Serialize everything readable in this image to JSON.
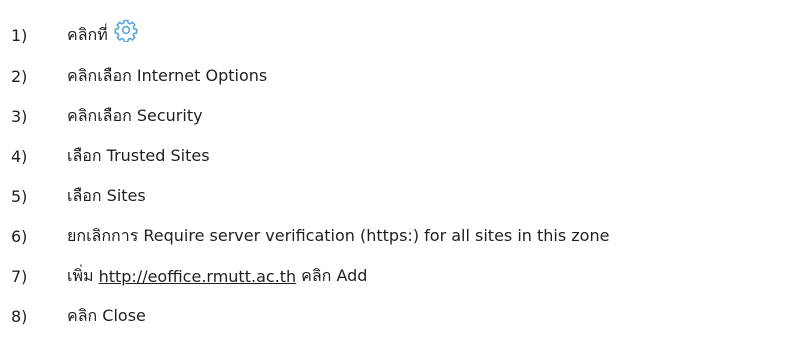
{
  "steps": [
    {
      "num": "1)",
      "text": "คลิกที่",
      "icon": "gear-icon",
      "icon_color": "#5aa7d6"
    },
    {
      "num": "2)",
      "text": "คลิกเลือก Internet Options"
    },
    {
      "num": "3)",
      "text": "คลิกเลือก Security"
    },
    {
      "num": "4)",
      "text": "เลือก Trusted Sites"
    },
    {
      "num": "5)",
      "text": "เลือก Sites"
    },
    {
      "num": "6)",
      "text": "ยกเลิกการ Require server verification (https:) for all sites in this zone"
    },
    {
      "num": "7)",
      "text_before": "เพิ่ม",
      "link": "http://eoffice.rmutt.ac.th",
      "text_after": "คลิก Add"
    },
    {
      "num": "8)",
      "text": "คลิก Close"
    }
  ]
}
